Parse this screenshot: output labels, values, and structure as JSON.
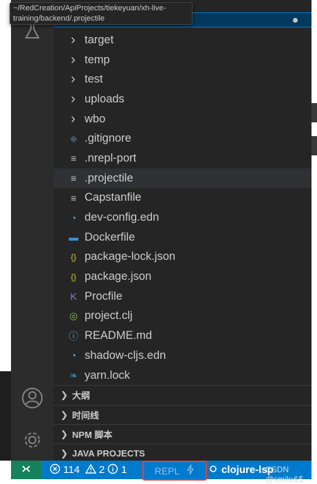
{
  "tooltip": {
    "path": "~/RedCreation/ApiProjects/tiekeyuan/xh-live-training/backend/.projectile"
  },
  "activity_bar": {
    "top_icon": "flask-icon",
    "bottom_icons": [
      "account-icon",
      "settings-gear-icon"
    ]
  },
  "explorer": {
    "items": [
      {
        "label": "target",
        "type": "folder",
        "icon": "chevron-right-icon"
      },
      {
        "label": "temp",
        "type": "folder",
        "icon": "chevron-right-icon"
      },
      {
        "label": "test",
        "type": "folder",
        "icon": "chevron-right-icon"
      },
      {
        "label": "uploads",
        "type": "folder",
        "icon": "chevron-right-icon"
      },
      {
        "label": "wbo",
        "type": "folder",
        "icon": "chevron-right-icon"
      },
      {
        "label": ".gitignore",
        "type": "file",
        "icon": "git-icon",
        "color": "#41535b"
      },
      {
        "label": ".nrepl-port",
        "type": "file",
        "icon": "text-lines-icon",
        "color": "#c5c5c5"
      },
      {
        "label": ".projectile",
        "type": "file",
        "icon": "text-lines-icon",
        "color": "#c5c5c5",
        "highlighted": true
      },
      {
        "label": "Capstanfile",
        "type": "file",
        "icon": "text-lines-icon",
        "color": "#c5c5c5"
      },
      {
        "label": "dev-config.edn",
        "type": "file",
        "icon": "edn-icon",
        "color": "#5ba4d6"
      },
      {
        "label": "Dockerfile",
        "type": "file",
        "icon": "docker-icon",
        "color": "#3d8fd1"
      },
      {
        "label": "package-lock.json",
        "type": "file",
        "icon": "json-braces-icon",
        "color": "#cbcb41"
      },
      {
        "label": "package.json",
        "type": "file",
        "icon": "json-braces-icon",
        "color": "#cbcb41"
      },
      {
        "label": "Procfile",
        "type": "file",
        "icon": "heroku-icon",
        "color": "#a074c4"
      },
      {
        "label": "project.clj",
        "type": "file",
        "icon": "clojure-icon",
        "color": "#8dc149"
      },
      {
        "label": "README.md",
        "type": "file",
        "icon": "info-icon",
        "color": "#5ba4d6"
      },
      {
        "label": "shadow-cljs.edn",
        "type": "file",
        "icon": "edn-icon",
        "color": "#5ba4d6"
      },
      {
        "label": "yarn.lock",
        "type": "file",
        "icon": "yarn-icon",
        "color": "#2c8ebb"
      }
    ]
  },
  "panels": [
    {
      "label": "大纲"
    },
    {
      "label": "时间线"
    },
    {
      "label": "NPM 脚本"
    },
    {
      "label": "JAVA PROJECTS"
    }
  ],
  "status_bar": {
    "remote_icon": "remote-icon",
    "errors": "114",
    "warnings": "2",
    "info": "1",
    "repl_label": "REPL",
    "repl_icon": "lightning-icon",
    "lsp_label": "clojure-lsp",
    "colors": {
      "background": "#007acc",
      "remote": "#16825d",
      "highlight_border": "#e0443e"
    }
  },
  "watermark": "CSDN @smile&$"
}
